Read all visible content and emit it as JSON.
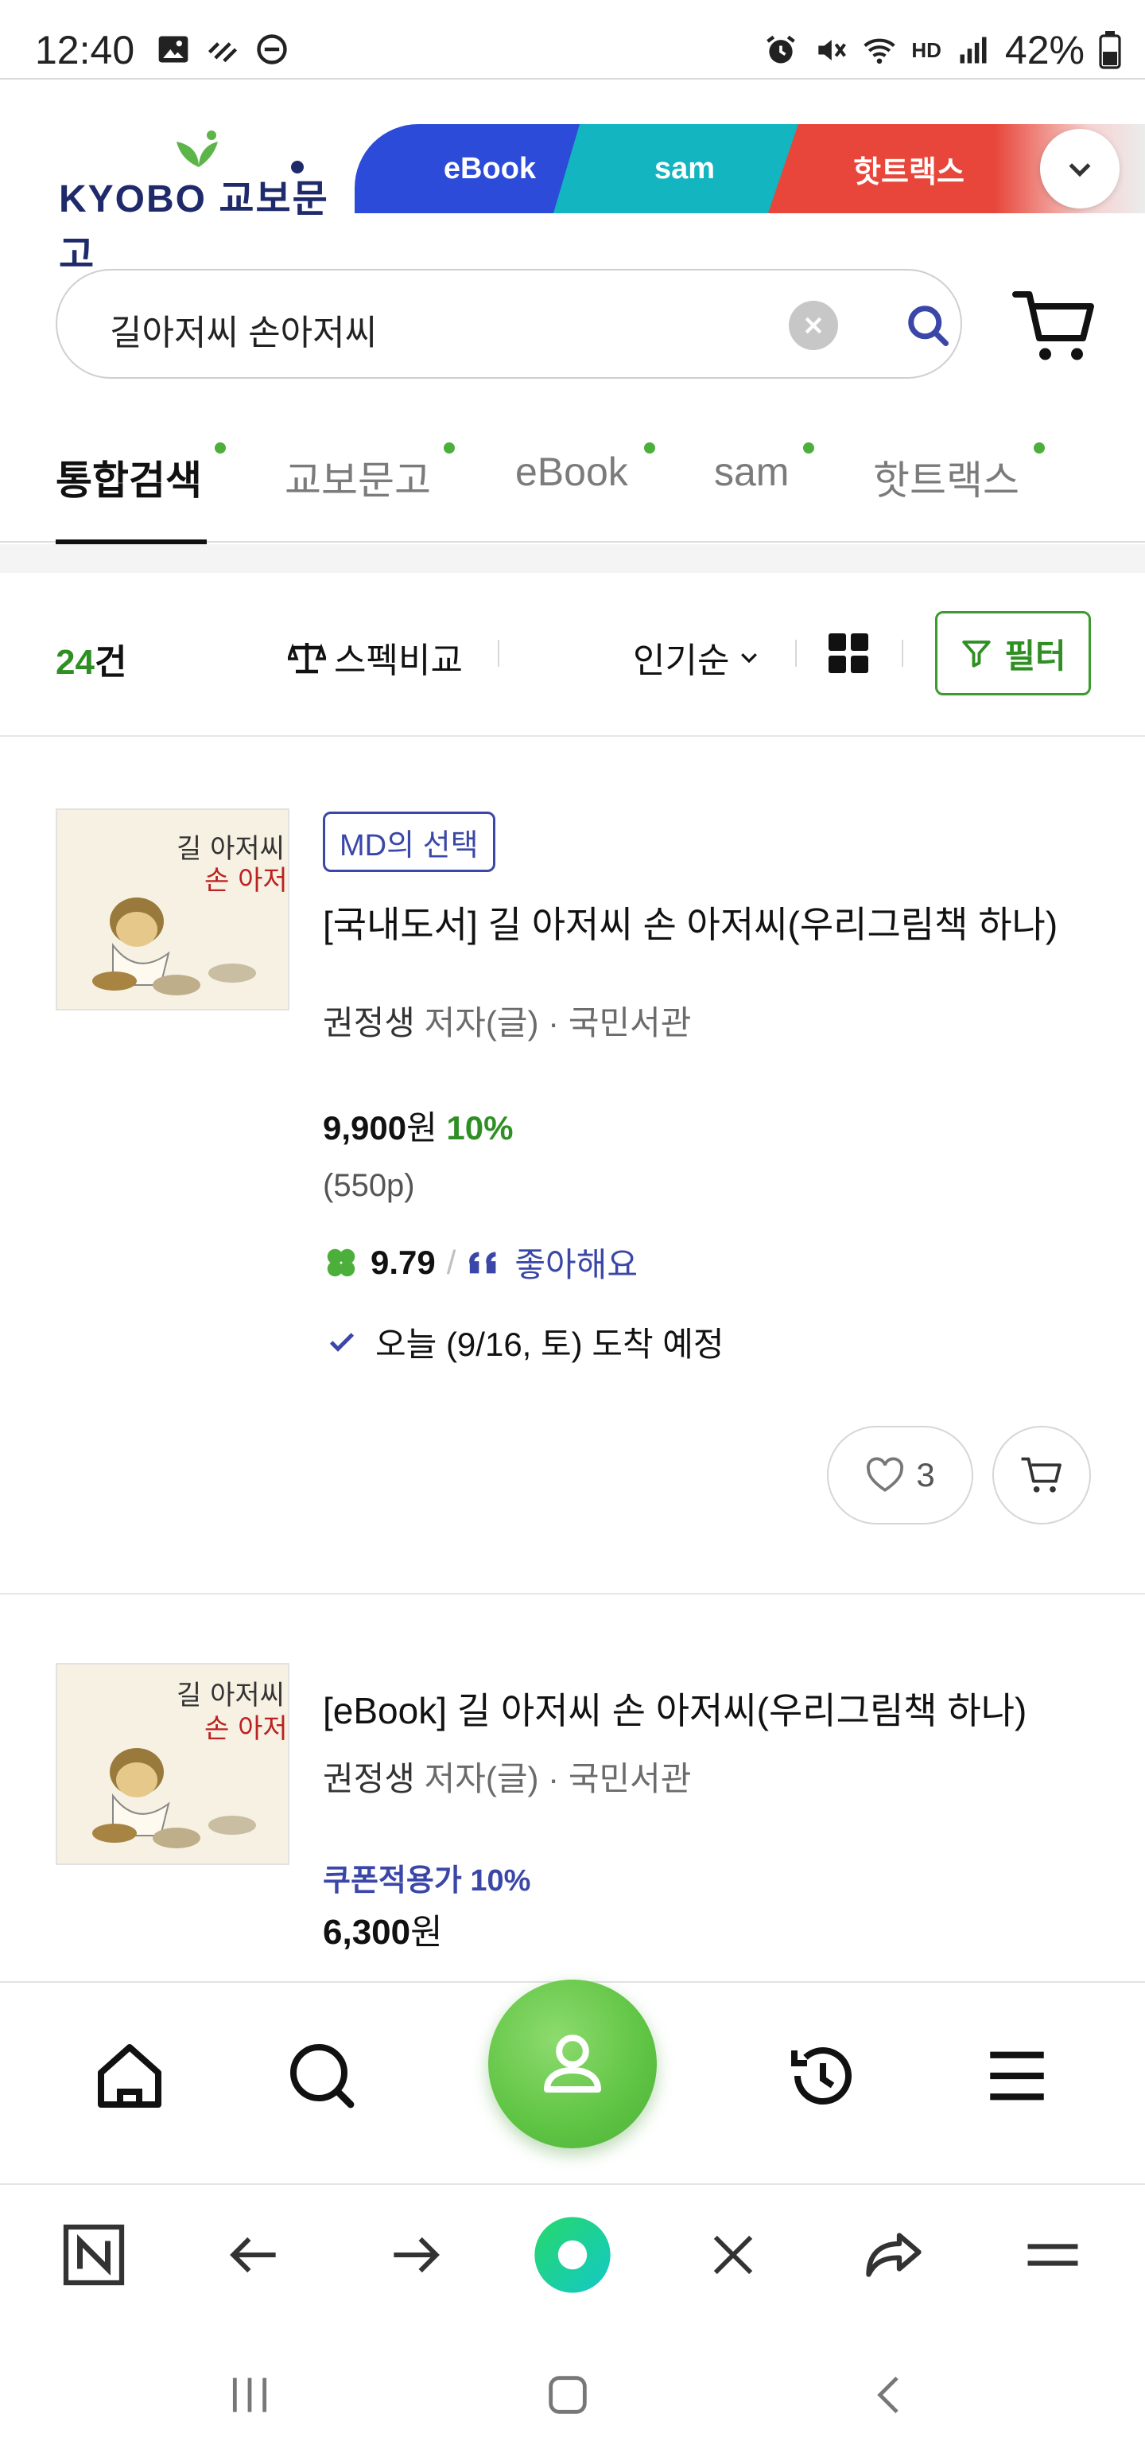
{
  "status_bar": {
    "time": "12:40",
    "battery": "42%",
    "network_label": "HD"
  },
  "header": {
    "logo_text": "KYOBO 교보문고",
    "channel_tabs": [
      {
        "label": "eBook",
        "color": "#2b4bd8"
      },
      {
        "label": "sam",
        "color": "#12b5c0"
      },
      {
        "label": "핫트랙스",
        "color": "#e8463a"
      }
    ]
  },
  "search": {
    "query": "길아저씨 손아저씨"
  },
  "category_tabs": [
    {
      "label": "통합검색",
      "active": true
    },
    {
      "label": "교보문고",
      "active": false
    },
    {
      "label": "eBook",
      "active": false
    },
    {
      "label": "sam",
      "active": false
    },
    {
      "label": "핫트랙스",
      "active": false
    }
  ],
  "toolbar": {
    "count_num": "24",
    "count_unit": "건",
    "spec_compare": "스펙비교",
    "sort": "인기순",
    "filter": "필터"
  },
  "products": [
    {
      "badge": "MD의 선택",
      "title": "[국내도서] 길 아저씨 손 아저씨(우리그림책 하나)",
      "author": "권정생",
      "author_role": "저자(글)",
      "publisher": "· 국민서관",
      "price": "9,900",
      "price_unit": "원",
      "discount": "10%",
      "pages": "(550p)",
      "rating": "9.79",
      "review": "좋아해요",
      "delivery": "오늘 (9/16, 토) 도착 예정",
      "likes": "3"
    },
    {
      "title": "[eBook] 길 아저씨 손 아저씨(우리그림책 하나)",
      "author": "권정생",
      "author_role": "저자(글)",
      "publisher": "· 국민서관",
      "coupon": "쿠폰적용가 10%",
      "price": "6,300",
      "price_unit": "원"
    }
  ],
  "colors": {
    "brand_green": "#4caf3b",
    "brand_navy": "#1f2a6b",
    "review_blue": "#3b47a8"
  },
  "icons": {
    "bottom_nav": [
      "home-icon",
      "search-icon",
      "my-page-icon",
      "recent-history-icon",
      "menu-icon"
    ],
    "browser_bar": [
      "naver-icon",
      "back-icon",
      "forward-icon",
      "green-dot-icon",
      "close-icon",
      "share-icon",
      "browser-menu-icon"
    ],
    "system_nav": [
      "recents-icon",
      "home-button-icon",
      "back-button-icon"
    ]
  }
}
